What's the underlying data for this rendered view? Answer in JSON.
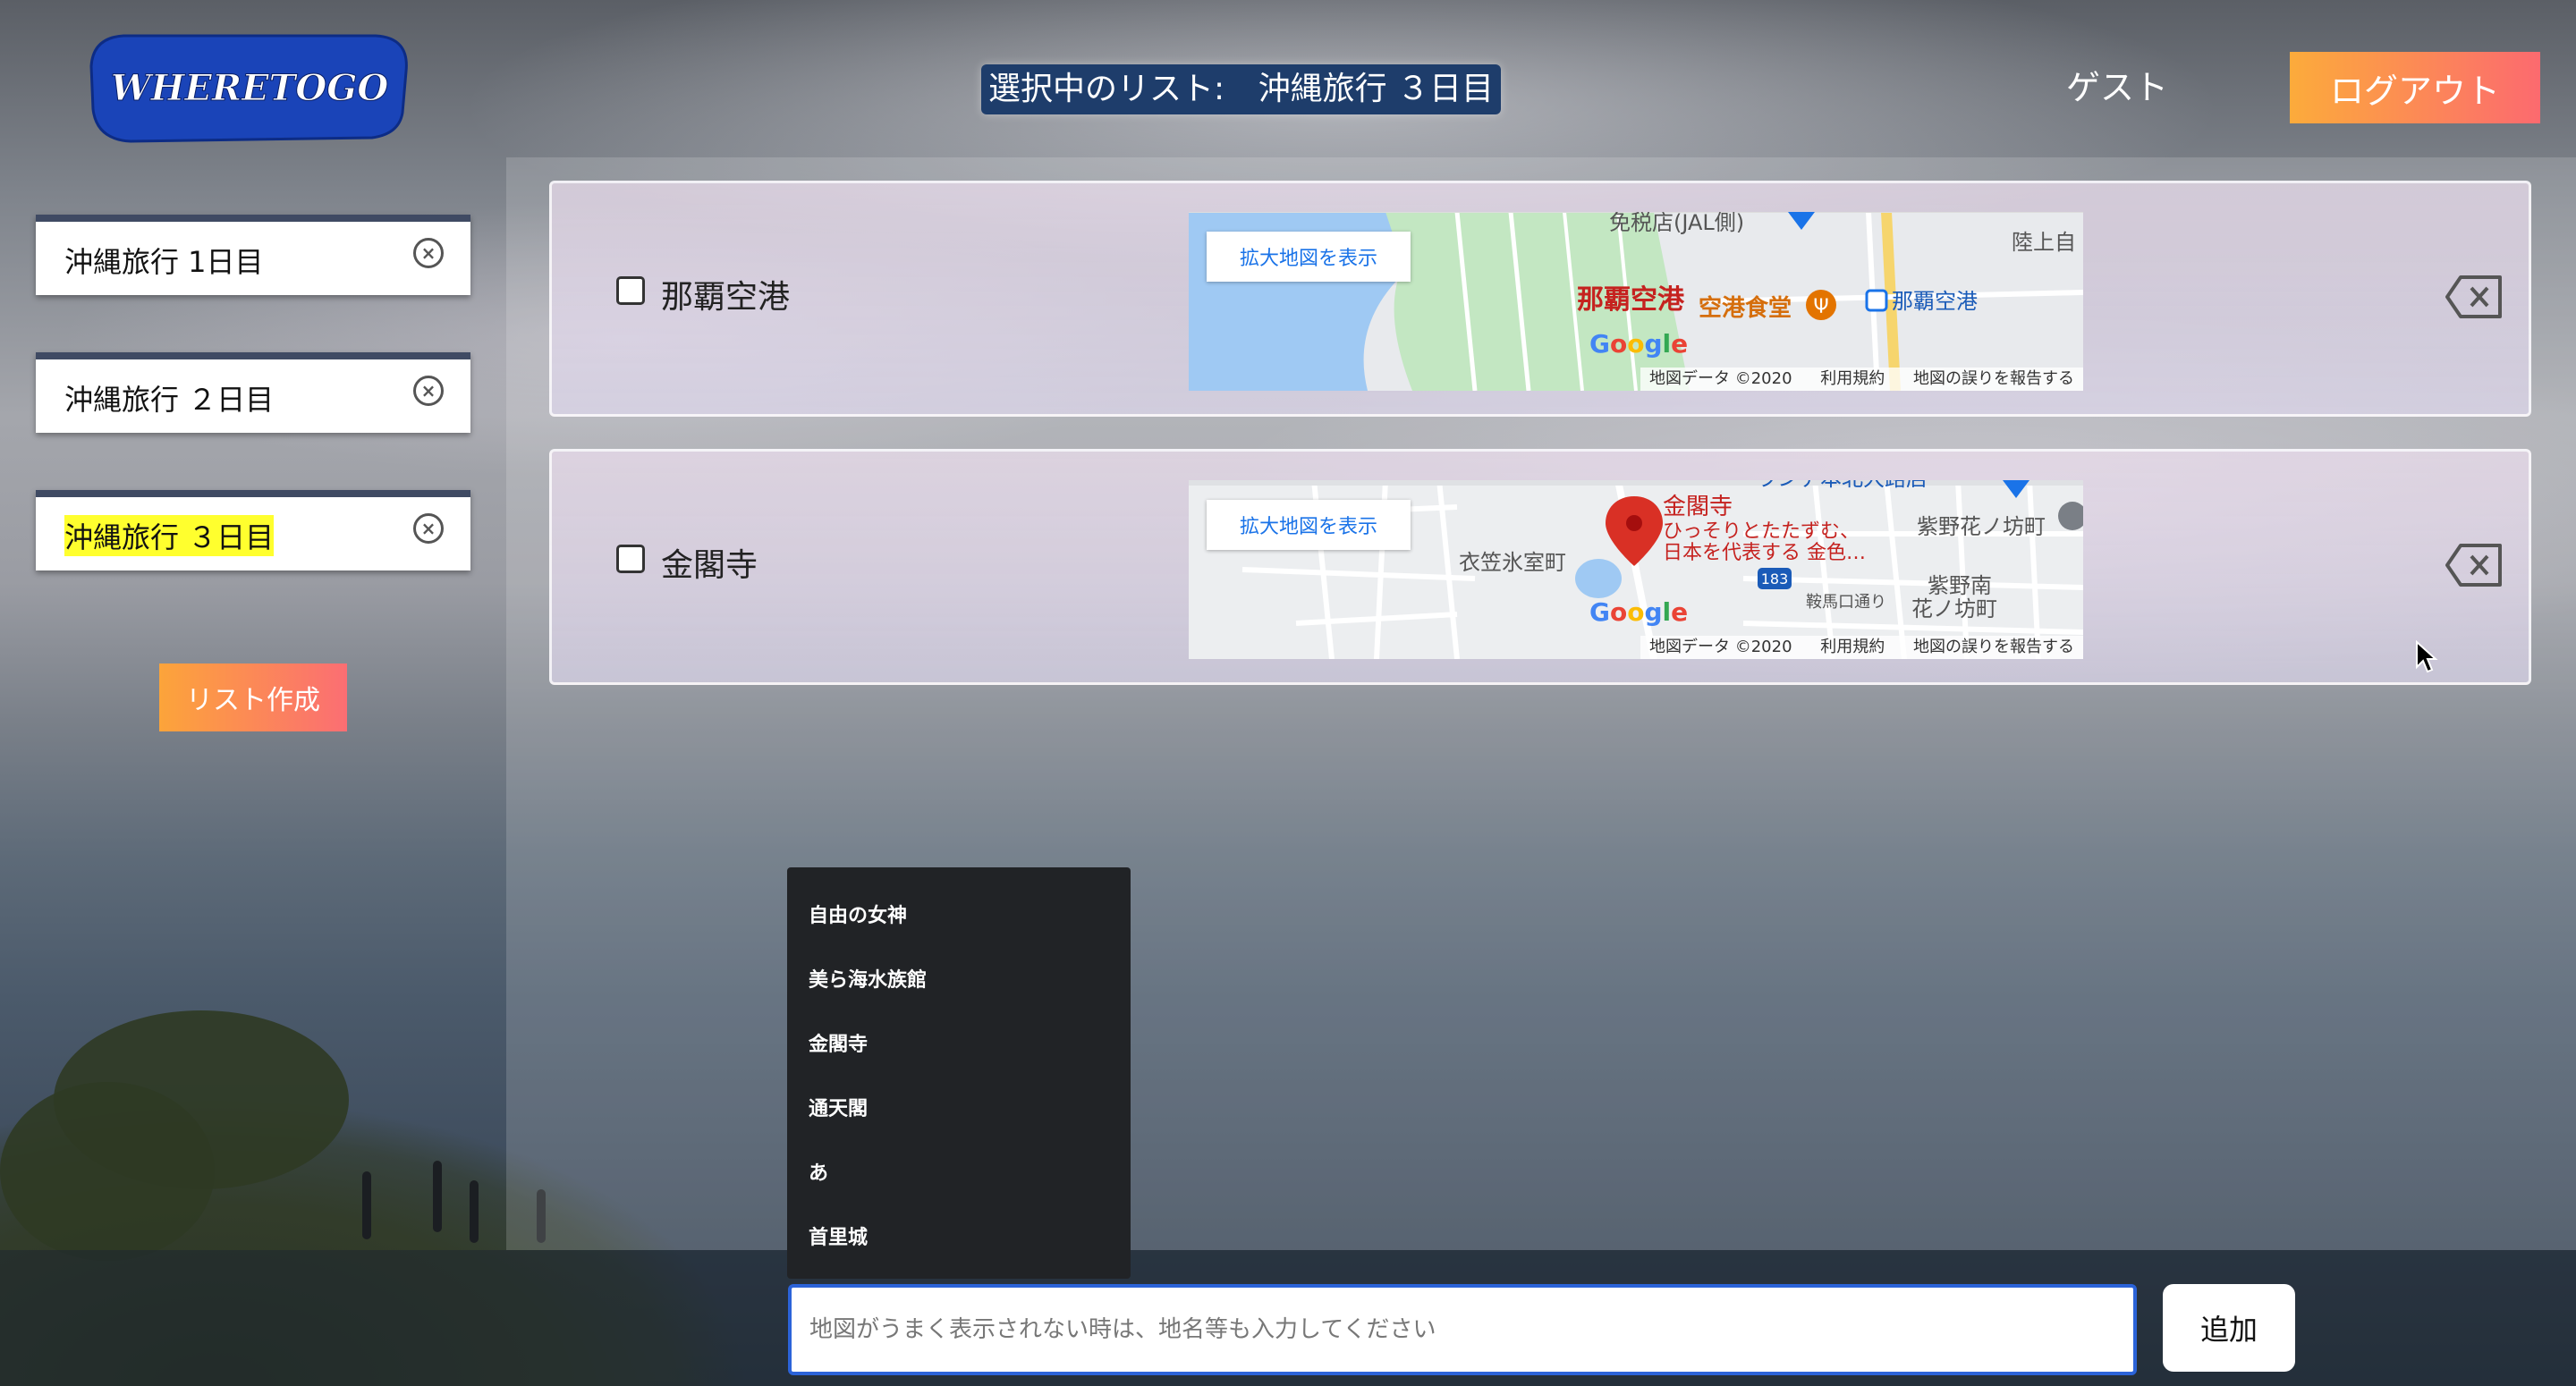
{
  "header": {
    "logo_text": "WHERETOGO",
    "selected_list_label": "選択中のリスト:",
    "selected_list_name": "沖縄旅行 ３日目",
    "user_name": "ゲスト",
    "logout_label": "ログアウト"
  },
  "sidebar": {
    "lists": [
      {
        "name": "沖縄旅行 1日目"
      },
      {
        "name": "沖縄旅行 ２日目"
      },
      {
        "name": "沖縄旅行 ３日目",
        "active": true
      }
    ],
    "create_label": "リスト作成"
  },
  "places": [
    {
      "name": "那覇空港",
      "map": {
        "enlarge_label": "拡大地図を表示",
        "labels": {
          "top": "免税店(JAL側)",
          "right": "陸上自",
          "main": "那覇空港",
          "food": "空港食堂",
          "station": "那覇空港"
        },
        "attribution": {
          "data": "地図データ ©2020",
          "terms": "利用規約",
          "report": "地図の誤りを報告する"
        }
      }
    },
    {
      "name": "金閣寺",
      "map": {
        "enlarge_label": "拡大地図を表示",
        "labels": {
          "pin_title": "金閣寺",
          "pin_desc1": "ひっそりとたたずむ、",
          "pin_desc2": "日本を代表する 金色…",
          "area1": "衣笠氷室町",
          "area2": "紫野花ノ坊町",
          "area3": "紫野南",
          "area4": "花ノ坊町",
          "road": "183",
          "street": "鞍馬口通り",
          "top": "ーランデ本北大路店"
        },
        "attribution": {
          "data": "地図データ ©2020",
          "terms": "利用規約",
          "report": "地図の誤りを報告する"
        }
      }
    }
  ],
  "suggestions": [
    "自由の女神",
    "美ら海水族館",
    "金閣寺",
    "通天閣",
    "あ",
    "首里城"
  ],
  "add_form": {
    "placeholder": "地図がうまく表示されない時は、地名等も入力してください",
    "add_label": "追加"
  },
  "colors": {
    "accent_start": "#fcab3b",
    "accent_end": "#fc6a6f",
    "header_badge": "#1e3d6b",
    "highlight": "#ffff2e"
  }
}
